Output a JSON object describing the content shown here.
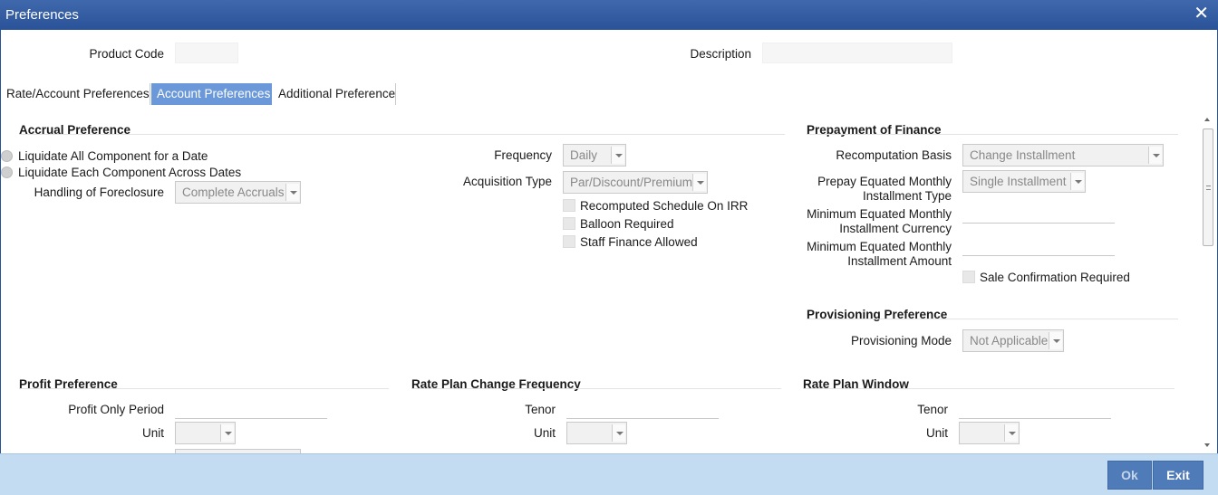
{
  "window": {
    "title": "Preferences",
    "close_glyph": "✕"
  },
  "header": {
    "product_code_label": "Product Code",
    "description_label": "Description"
  },
  "tabs": [
    {
      "label": "Rate/Account Preferences",
      "active": false
    },
    {
      "label": "Account Preferences",
      "active": true
    },
    {
      "label": "Additional Preference",
      "active": false
    }
  ],
  "accrual": {
    "title": "Accrual Preference",
    "radio_1": "Liquidate All Component for a Date",
    "radio_2": "Liquidate Each Component Across Dates",
    "foreclosure_label": "Handling of Foreclosure",
    "foreclosure_value": "Complete Accruals",
    "frequency_label": "Frequency",
    "frequency_value": "Daily",
    "acquisition_label": "Acquisition Type",
    "acquisition_value": "Par/Discount/Premium",
    "chk_recomputed": "Recomputed Schedule On IRR",
    "chk_balloon": "Balloon Required",
    "chk_staff": "Staff Finance Allowed"
  },
  "prepayment": {
    "title": "Prepayment of Finance",
    "recomp_label": "Recomputation Basis",
    "recomp_value": "Change Installment",
    "emi_type_label_1": "Prepay Equated Monthly",
    "emi_type_label_2": "Installment Type",
    "emi_type_value": "Single Installment",
    "min_ccy_label_1": "Minimum Equated Monthly",
    "min_ccy_label_2": "Installment Currency",
    "min_amt_label_1": "Minimum Equated Monthly",
    "min_amt_label_2": "Installment Amount",
    "sale_confirm": "Sale Confirmation Required"
  },
  "provisioning": {
    "title": "Provisioning Preference",
    "mode_label": "Provisioning Mode",
    "mode_value": "Not Applicable"
  },
  "profit": {
    "title": "Profit Preference",
    "period_label": "Profit Only Period",
    "unit_label": "Unit"
  },
  "rate_plan_change": {
    "title": "Rate Plan Change Frequency",
    "tenor_label": "Tenor",
    "unit_label": "Unit"
  },
  "rate_plan_window": {
    "title": "Rate Plan Window",
    "tenor_label": "Tenor",
    "unit_label": "Unit"
  },
  "footer": {
    "ok_label": "Ok",
    "exit_label": "Exit"
  },
  "colors": {
    "titlebar": "#2a5298",
    "active_tab": "#6a98d8",
    "footer": "#c4dcf1",
    "button": "#4f7bb8"
  }
}
